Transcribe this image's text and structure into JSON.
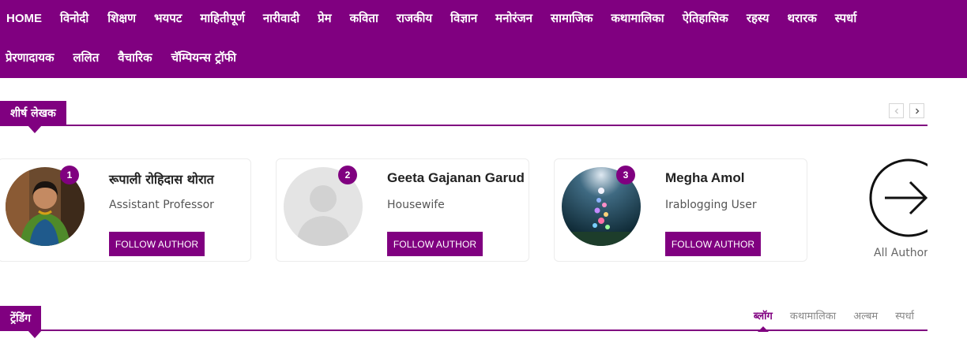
{
  "nav": {
    "row1": [
      "HOME",
      "विनोदी",
      "शिक्षण",
      "भयपट",
      "माहितीपूर्ण",
      "नारीवादी",
      "प्रेम",
      "कविता",
      "राजकीय",
      "विज्ञान",
      "मनोरंजन",
      "सामाजिक",
      "कथामालिका",
      "ऐतिहासिक",
      "रहस्य",
      "थरारक",
      "स्पर्धा"
    ],
    "row2": [
      "प्रेरणादायक",
      "ललित",
      "वैचारिक",
      "चॅम्पियन्स ट्रॉफी"
    ]
  },
  "top_authors": {
    "title": "शीर्ष लेखक",
    "authors": [
      {
        "rank": "1",
        "name": "रूपाली रोहिदास थोरात",
        "role": "Assistant Professor",
        "follow_label": "FOLLOW AUTHOR"
      },
      {
        "rank": "2",
        "name": "Geeta Gajanan Garud",
        "role": "Housewife",
        "follow_label": "FOLLOW AUTHOR"
      },
      {
        "rank": "3",
        "name": "Megha Amol",
        "role": "Irablogging User",
        "follow_label": "FOLLOW AUTHOR"
      }
    ],
    "all_authors_label": "All Authors"
  },
  "trending": {
    "title": "ट्रेंडिंग",
    "tabs": [
      "ब्लॉग",
      "कथामालिका",
      "अल्बम",
      "स्पर्धा"
    ],
    "active_tab": "ब्लॉग"
  },
  "colors": {
    "brand": "#800080"
  },
  "icons": {
    "prev": "chevron-left-icon",
    "next": "chevron-right-icon",
    "all_authors": "arrow-right-circle-icon"
  }
}
